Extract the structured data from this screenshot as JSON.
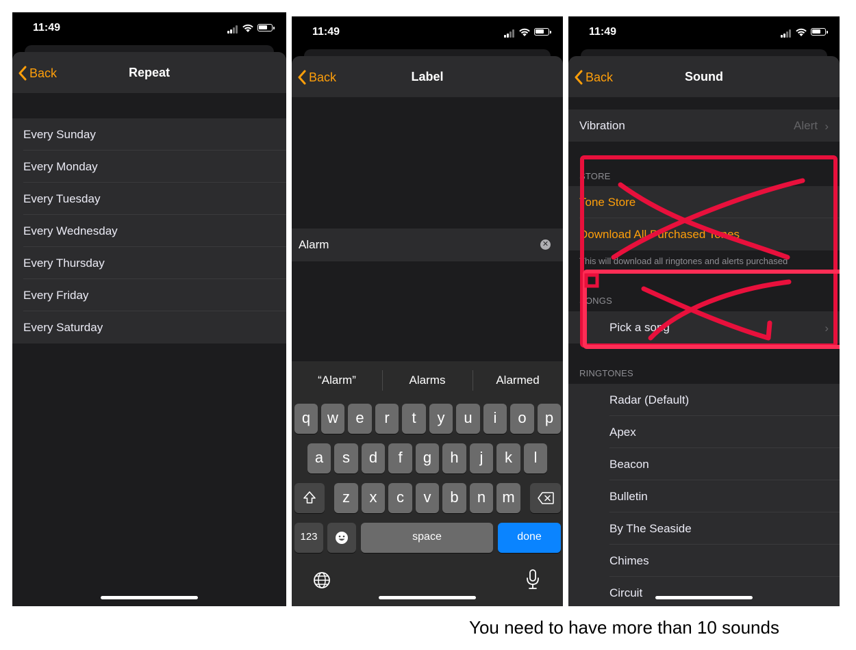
{
  "status": {
    "time": "11:49"
  },
  "repeat": {
    "back_label": "Back",
    "title": "Repeat",
    "days": [
      "Every Sunday",
      "Every Monday",
      "Every Tuesday",
      "Every Wednesday",
      "Every Thursday",
      "Every Friday",
      "Every Saturday"
    ]
  },
  "label_screen": {
    "back_label": "Back",
    "title": "Label",
    "field_value": "Alarm",
    "suggestions": [
      "“Alarm”",
      "Alarms",
      "Alarmed"
    ],
    "row1": [
      "q",
      "w",
      "e",
      "r",
      "t",
      "y",
      "u",
      "i",
      "o",
      "p"
    ],
    "row2": [
      "a",
      "s",
      "d",
      "f",
      "g",
      "h",
      "j",
      "k",
      "l"
    ],
    "row3": [
      "z",
      "x",
      "c",
      "v",
      "b",
      "n",
      "m"
    ],
    "numbers_key": "123",
    "space_key": "space",
    "done_key": "done"
  },
  "sound": {
    "back_label": "Back",
    "title": "Sound",
    "vibration_label": "Vibration",
    "vibration_value": "Alert",
    "store_header": "STORE",
    "tone_store": "Tone Store",
    "download_all": "Download All Purchased Tones",
    "store_footnote": "This will download all ringtones and alerts purchased",
    "songs_header": "SONGS",
    "pick_song": "Pick a song",
    "ringtones_header": "RINGTONES",
    "ringtones": [
      "Radar (Default)",
      "Apex",
      "Beacon",
      "Bulletin",
      "By The Seaside",
      "Chimes",
      "Circuit"
    ],
    "annotation_color": "#e8103c"
  },
  "caption": "You need to have more than 10 sounds",
  "colors": {
    "accent": "#ff9f0a",
    "done": "#0a84ff",
    "background": "#1c1c1e",
    "cell": "#2c2c2e"
  }
}
